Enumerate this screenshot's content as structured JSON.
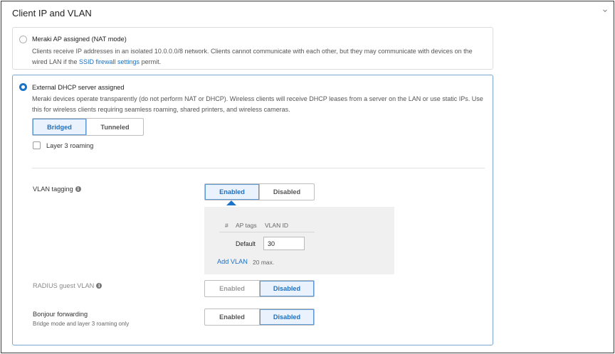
{
  "section": {
    "title": "Client IP and VLAN"
  },
  "options": [
    {
      "label": "Meraki AP assigned (NAT mode)",
      "selected": false,
      "description_before_link": "Clients receive IP addresses in an isolated 10.0.0.0/8 network. Clients cannot communicate with each other, but they may communicate with devices on the wired LAN if the ",
      "link_text": "SSID firewall settings",
      "description_after_link": " permit."
    },
    {
      "label": "External DHCP server assigned",
      "selected": true,
      "description": "Meraki devices operate transparently (do not perform NAT or DHCP). Wireless clients will receive DHCP leases from a server on the LAN or use static IPs. Use this for wireless clients requiring seamless roaming, shared printers, and wireless cameras."
    }
  ],
  "mode_toggle": {
    "bridged": "Bridged",
    "tunneled": "Tunneled",
    "selected": "Bridged"
  },
  "layer3_roaming": {
    "label": "Layer 3 roaming",
    "checked": false
  },
  "vlan_tagging": {
    "label": "VLAN tagging",
    "enabled": "Enabled",
    "disabled": "Disabled",
    "selected": "Enabled",
    "table": {
      "headers": [
        "#",
        "AP tags",
        "VLAN ID"
      ],
      "row_label": "Default",
      "vlan_id": "30"
    },
    "add_vlan": "Add VLAN",
    "max_note": "20 max."
  },
  "radius_guest_vlan": {
    "label": "RADIUS guest VLAN",
    "enabled": "Enabled",
    "disabled": "Disabled",
    "selected": "Disabled"
  },
  "bonjour_forwarding": {
    "label": "Bonjour forwarding",
    "sublabel": "Bridge mode and layer 3 roaming only",
    "enabled": "Enabled",
    "disabled": "Disabled",
    "selected": "Disabled"
  },
  "icons": {
    "info": "info-icon",
    "collapse": "chevron-down-icon"
  },
  "colors": {
    "accent": "#1b72c6",
    "link": "#1b6fc2",
    "selected_fill": "#eaf3fd"
  }
}
